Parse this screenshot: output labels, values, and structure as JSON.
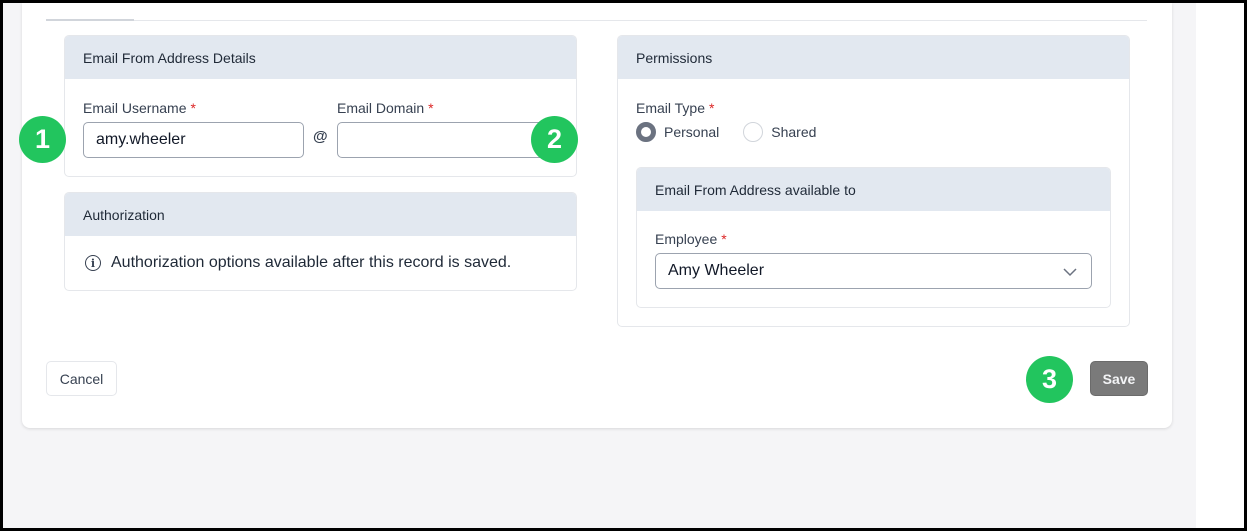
{
  "email_details": {
    "title": "Email From Address Details",
    "username_label": "Email Username",
    "username_value": "amy.wheeler",
    "at_symbol": "@",
    "domain_label": "Email Domain",
    "domain_value": "",
    "required_mark": "*"
  },
  "authorization": {
    "title": "Authorization",
    "info_icon": "i",
    "info_text": "Authorization options available after this record is saved."
  },
  "permissions": {
    "title": "Permissions",
    "email_type_label": "Email Type",
    "options": [
      {
        "label": "Personal",
        "checked": true
      },
      {
        "label": "Shared",
        "checked": false
      }
    ],
    "available_to": {
      "title": "Email From Address available to",
      "employee_label": "Employee",
      "employee_value": "Amy Wheeler"
    }
  },
  "actions": {
    "cancel_label": "Cancel",
    "save_label": "Save"
  },
  "badges": [
    "1",
    "2",
    "3"
  ],
  "colors": {
    "badge": "#22c55e",
    "panel_header": "#e2e8f0",
    "required": "#dc2626",
    "save_button": "#7a7a7a"
  }
}
